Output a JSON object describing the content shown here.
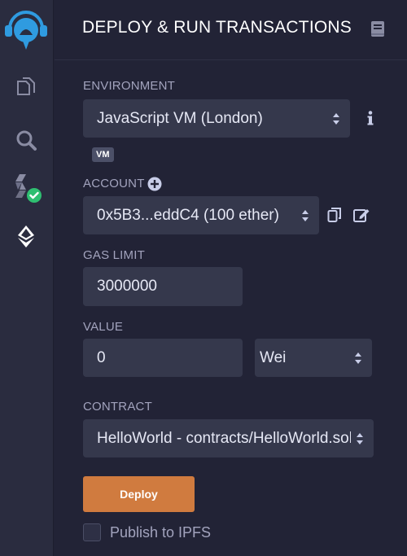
{
  "panel": {
    "title": "DEPLOY & RUN TRANSACTIONS"
  },
  "environment": {
    "label": "ENVIRONMENT",
    "selected": "JavaScript VM (London)",
    "badge": "VM"
  },
  "account": {
    "label": "ACCOUNT",
    "selected": "0x5B3...eddC4 (100 ether)"
  },
  "gas_limit": {
    "label": "GAS LIMIT",
    "value": "3000000"
  },
  "value": {
    "label": "VALUE",
    "amount": "0",
    "unit": "Wei"
  },
  "contract": {
    "label": "CONTRACT",
    "selected": "HelloWorld - contracts/HelloWorld.sol"
  },
  "deploy": {
    "label": "Deploy"
  },
  "publish": {
    "label": "Publish to IPFS",
    "checked": false
  },
  "colors": {
    "sidebar_bg": "#2a2c3f",
    "panel_bg": "#222336",
    "control_bg": "#35384c",
    "accent_orange": "#d07b3f",
    "logo_blue": "#2f9be0",
    "success_green": "#2fbf71",
    "label_text": "#a2a3bd"
  },
  "icons": {
    "logo": "remix-logo",
    "file_explorer": "files-icon",
    "search": "search-icon",
    "compiler": "solidity-compiler-icon",
    "deploy": "ethereum-icon",
    "docs": "book-icon",
    "info": "info-icon",
    "add_account": "plus-circle-icon",
    "copy": "copy-icon",
    "edit": "edit-icon"
  }
}
